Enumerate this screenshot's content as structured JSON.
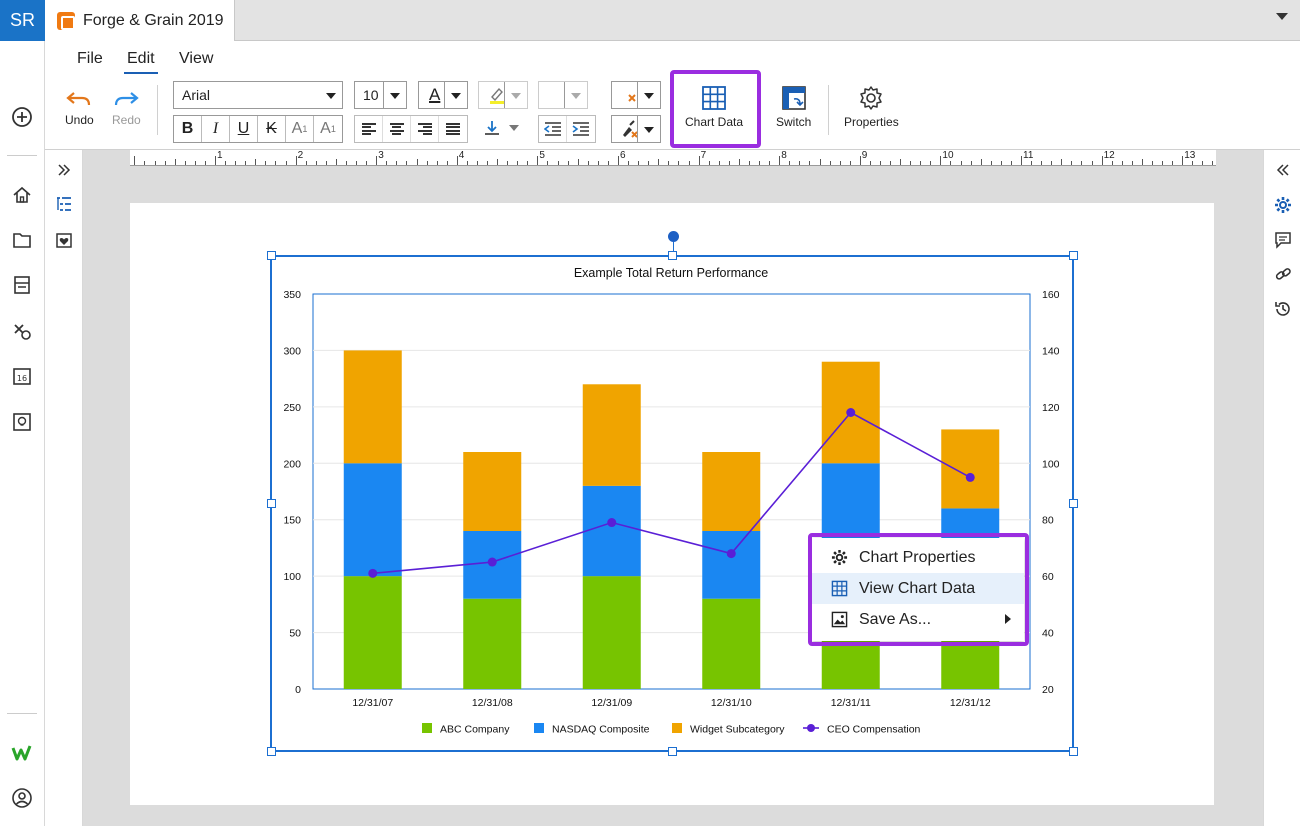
{
  "app": {
    "user_initials": "SR",
    "document_tab": "Forge & Grain 2019"
  },
  "menu": {
    "file": "File",
    "edit": "Edit",
    "view": "View"
  },
  "toolbar": {
    "undo": "Undo",
    "redo": "Redo",
    "font_family": "Arial",
    "font_size": "10",
    "chart_data": "Chart Data",
    "switch": "Switch",
    "properties": "Properties",
    "font_color_letter": "A"
  },
  "ruler": {
    "numbers": [
      "1",
      "2",
      "3",
      "4",
      "5",
      "6",
      "7",
      "8",
      "9",
      "10",
      "11",
      "12",
      "13"
    ]
  },
  "colors": {
    "abc": "#77c400",
    "nasdaq": "#1a87f2",
    "widget": "#f0a400",
    "ceo": "#5a1fd6",
    "highlight": "#9a2de0"
  },
  "chart_data": {
    "type": "bar",
    "stacked": true,
    "title": "Example Total Return Performance",
    "categories": [
      "12/31/07",
      "12/31/08",
      "12/31/09",
      "12/31/10",
      "12/31/11",
      "12/31/12"
    ],
    "series": [
      {
        "name": "ABC Company",
        "type": "bar",
        "values": [
          100,
          80,
          100,
          80,
          80,
          80
        ]
      },
      {
        "name": "NASDAQ Composite",
        "type": "bar",
        "values": [
          100,
          60,
          80,
          60,
          120,
          80
        ]
      },
      {
        "name": "Widget Subcategory",
        "type": "bar",
        "values": [
          100,
          70,
          90,
          70,
          90,
          70
        ]
      },
      {
        "name": "CEO Compensation",
        "type": "line",
        "axis": "right",
        "values": [
          61,
          65,
          79,
          68,
          118,
          95
        ]
      }
    ],
    "ylim": [
      0,
      350
    ],
    "y_ticks": [
      "0",
      "50",
      "100",
      "150",
      "200",
      "250",
      "300",
      "350"
    ],
    "y2lim": [
      20,
      160
    ],
    "y2_ticks": [
      "20",
      "40",
      "60",
      "80",
      "100",
      "120",
      "140",
      "160"
    ],
    "legend": "bottom",
    "grid": true
  },
  "context_menu": {
    "chart_properties": "Chart Properties",
    "view_chart_data": "View Chart Data",
    "save_as": "Save As..."
  }
}
